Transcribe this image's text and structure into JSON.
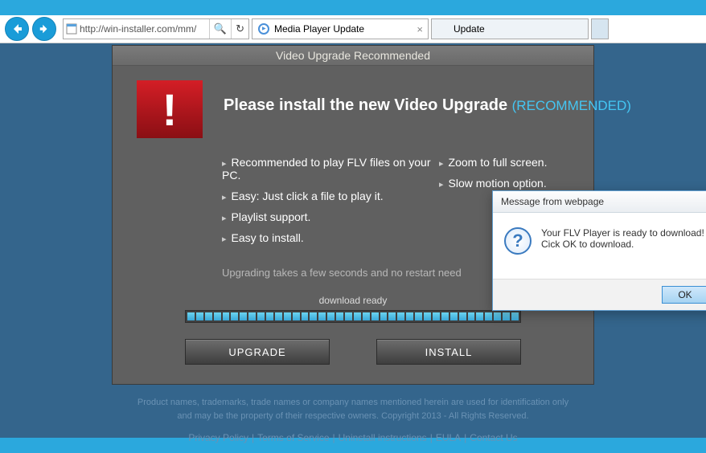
{
  "browser": {
    "url": "http://win-installer.com/mm/",
    "tabs": [
      {
        "title": "Media Player Update",
        "active": true
      },
      {
        "title": "Update",
        "active": false
      }
    ]
  },
  "content": {
    "header": "Video Upgrade Recommended",
    "headline_main": "Please install the new Video Upgrade",
    "headline_rec": "(RECOMMENDED)",
    "features_left": [
      "Recommended to play FLV files on your PC.",
      "Easy: Just click a file to play it.",
      "Playlist support.",
      "Easy to install."
    ],
    "features_right": [
      "Zoom to full screen.",
      "Slow motion option."
    ],
    "upgrade_msg": "Upgrading takes a few seconds and no restart need",
    "download_label": "download ready",
    "upgrade_btn": "UPGRADE",
    "install_btn": "INSTALL"
  },
  "footer": {
    "line1": "Product names, trademarks, trade names or company names mentioned herein are used for identification only",
    "line2": "and may be the property of their respective owners. Copyright 2013 - All Rights Reserved.",
    "links": [
      "Privacy Policy",
      "Terms of Service",
      "Uninstall instructions",
      "EULA",
      "Contact Us"
    ]
  },
  "dialog": {
    "title": "Message from webpage",
    "line1": "Your FLV Player is ready to download!",
    "line2": "Cick OK to download.",
    "ok": "OK"
  }
}
